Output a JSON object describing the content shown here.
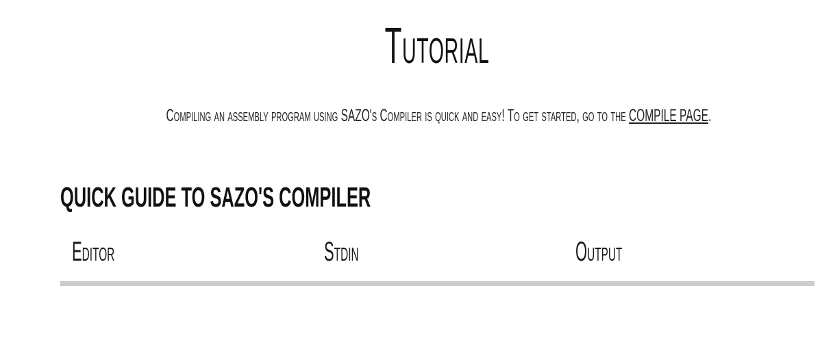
{
  "page": {
    "title": "Tutorial"
  },
  "intro": {
    "text": "Compiling an assembly program using SAZO's Compiler is quick and easy! To get started, go to the ",
    "link_label": "COMPILE PAGE",
    "suffix": "."
  },
  "guide": {
    "heading": "QUICK GUIDE TO SAZO'S COMPILER",
    "tabs": [
      {
        "label": "Editor"
      },
      {
        "label": "Stdin"
      },
      {
        "label": "Output"
      }
    ]
  },
  "colors": {
    "text": "#111111",
    "tab_underline": "#cccccc",
    "background": "#ffffff"
  }
}
